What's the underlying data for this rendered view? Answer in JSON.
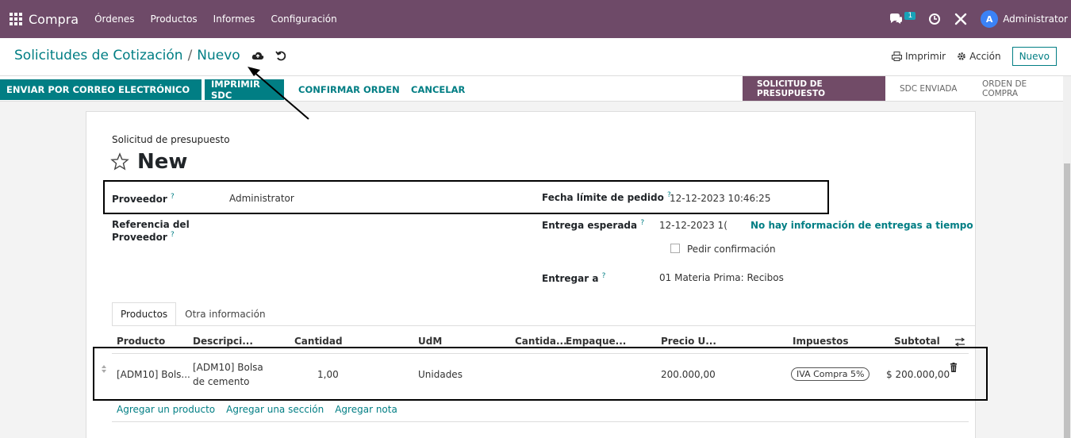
{
  "navbar": {
    "app_name": "Compra",
    "menu": [
      "Órdenes",
      "Productos",
      "Informes",
      "Configuración"
    ],
    "chat_count": "1",
    "avatar_letter": "A",
    "user_name": "Administrator"
  },
  "breadcrumb": {
    "parent": "Solicitudes de Cotización",
    "separator": "/",
    "current": "Nuevo"
  },
  "top_actions": {
    "print": "Imprimir",
    "action": "Acción",
    "new": "Nuevo"
  },
  "statusbar": {
    "buttons": [
      "ENVIAR POR CORREO ELECTRÓNICO",
      "IMPRIMIR SDC",
      "CONFIRMAR ORDEN",
      "CANCELAR"
    ],
    "stages": [
      "SOLICITUD DE PRESUPUESTO",
      "SDC ENVIADA",
      "ORDEN DE COMPRA"
    ]
  },
  "form": {
    "subtitle": "Solicitud de presupuesto",
    "title": "New",
    "proveedor_label": "Proveedor",
    "proveedor_value": "Administrator",
    "ref_label_1": "Referencia del",
    "ref_label_2": "Proveedor",
    "fecha_limite_label": "Fecha límite de pedido",
    "fecha_limite_value": "12-12-2023 10:46:25",
    "entrega_esperada_label": "Entrega esperada",
    "entrega_esperada_value": "12-12-2023 1(",
    "entrega_info": "No hay información de entregas a tiempo",
    "pedir_confirmacion": "Pedir confirmación",
    "entregar_a_label": "Entregar a",
    "entregar_a_value": "01 Materia Prima: Recibos",
    "help_mark": "?"
  },
  "tabs": [
    "Productos",
    "Otra información"
  ],
  "table": {
    "headers": [
      "Producto",
      "Descripci...",
      "Cantidad",
      "UdM",
      "Cantida...",
      "Empaque...",
      "Precio U...",
      "Impuestos",
      "Subtotal"
    ],
    "row": {
      "producto": "[ADM10] Bols...",
      "descripcion_1": "[ADM10] Bolsa",
      "descripcion_2": "de cemento",
      "cantidad": "1,00",
      "udm": "Unidades",
      "precio": "200.000,00",
      "impuesto": "IVA Compra 5%",
      "subtotal": "$ 200.000,00"
    },
    "add_links": [
      "Agregar un producto",
      "Agregar una sección",
      "Agregar nota"
    ]
  }
}
